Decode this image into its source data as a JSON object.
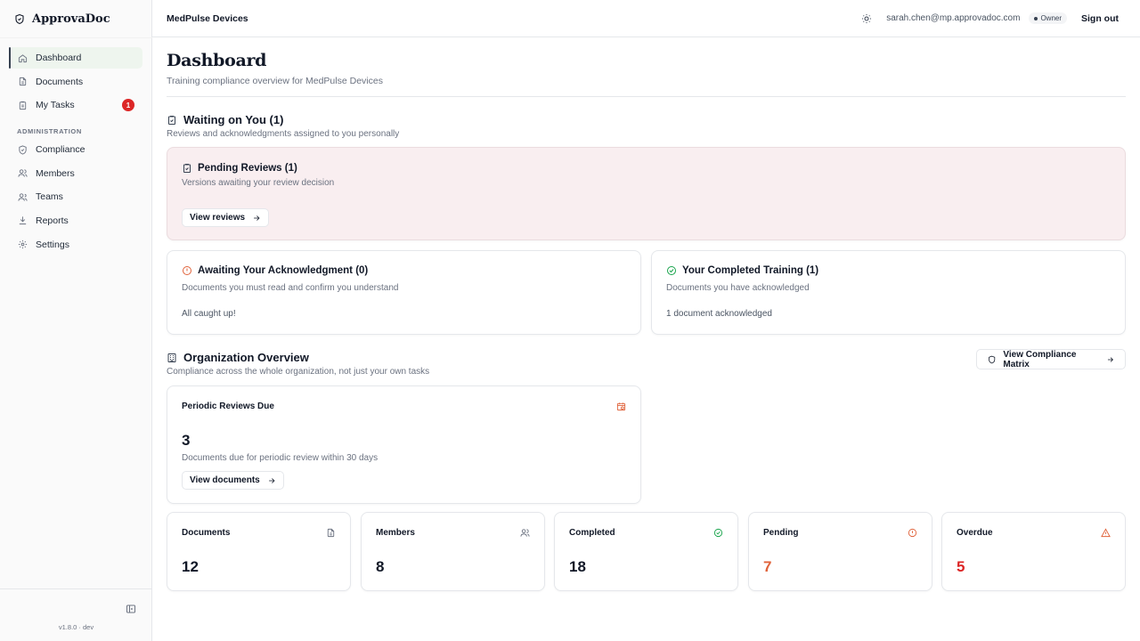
{
  "app": {
    "name": "ApprovaDoc",
    "version": "v1.8.0 · dev"
  },
  "sidebar": {
    "items": [
      {
        "label": "Dashboard"
      },
      {
        "label": "Documents"
      },
      {
        "label": "My Tasks",
        "badge": "1"
      }
    ],
    "admin_section": "ADMINISTRATION",
    "admin_items": [
      {
        "label": "Compliance"
      },
      {
        "label": "Members"
      },
      {
        "label": "Teams"
      },
      {
        "label": "Reports"
      },
      {
        "label": "Settings"
      }
    ]
  },
  "topbar": {
    "org": "MedPulse Devices",
    "email": "sarah.chen@mp.approvadoc.com",
    "role": "Owner",
    "signout": "Sign out"
  },
  "page": {
    "title": "Dashboard",
    "subtitle": "Training compliance overview for MedPulse Devices"
  },
  "waiting": {
    "title": "Waiting on You (1)",
    "subtitle": "Reviews and acknowledgments assigned to you personally",
    "pending": {
      "title": "Pending Reviews (1)",
      "text": "Versions awaiting your review decision",
      "button": "View reviews"
    },
    "ack": {
      "title": "Awaiting Your Acknowledgment (0)",
      "text": "Documents you must read and confirm you understand",
      "status": "All caught up!"
    },
    "completed": {
      "title": "Your Completed Training (1)",
      "text": "Documents you have acknowledged",
      "status": "1 document acknowledged"
    }
  },
  "org_overview": {
    "title": "Organization Overview",
    "subtitle": "Compliance across the whole organization, not just your own tasks",
    "matrix_button": "View Compliance Matrix",
    "periodic": {
      "title": "Periodic Reviews Due",
      "value": "3",
      "text": "Documents due for periodic review within 30 days",
      "button": "View documents"
    }
  },
  "stats": [
    {
      "label": "Documents",
      "value": "12",
      "icon": "file-icon",
      "color": "#111827"
    },
    {
      "label": "Members",
      "value": "8",
      "icon": "users-icon",
      "color": "#111827"
    },
    {
      "label": "Completed",
      "value": "18",
      "icon": "check-circle-icon",
      "color": "#111827"
    },
    {
      "label": "Pending",
      "value": "7",
      "icon": "alert-circle-icon",
      "color": "#e0623a"
    },
    {
      "label": "Overdue",
      "value": "5",
      "icon": "warning-triangle-icon",
      "color": "#dc2626"
    }
  ],
  "colors": {
    "accent_green": "#16a34a",
    "warning_orange": "#e0623a",
    "danger_red": "#dc2626",
    "pending_card_bg": "#f9eef0"
  }
}
